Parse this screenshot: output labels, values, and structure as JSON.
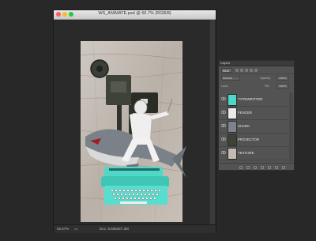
{
  "window": {
    "title": "WS_ANIMATE.psd @ 66.7% (RGB/8)",
    "zoom_status": "66.67%",
    "doc_status": "Doc: 8.50M/27.3M"
  },
  "layers_panel": {
    "tab": "Layers",
    "kind_filter": "Kind",
    "blend_mode": "Normal",
    "opacity_label": "Opacity:",
    "opacity_value": "100%",
    "lock_label": "Lock:",
    "fill_label": "Fill:",
    "fill_value": "100%",
    "layers": [
      {
        "name": "TYPEWRITTER"
      },
      {
        "name": "FENCER"
      },
      {
        "name": "SHARK"
      },
      {
        "name": "PROJECTOR"
      },
      {
        "name": "TEXTURE"
      }
    ]
  },
  "colors": {
    "accent_teal": "#4fd8c8",
    "panel_bg": "#535353",
    "workspace_bg": "#282828"
  },
  "icons": [
    "close-icon",
    "minimize-icon",
    "zoom-icon",
    "eye-icon",
    "link-layers-icon",
    "fx-icon",
    "mask-icon",
    "adjustment-icon",
    "group-icon",
    "new-layer-icon",
    "trash-icon"
  ]
}
